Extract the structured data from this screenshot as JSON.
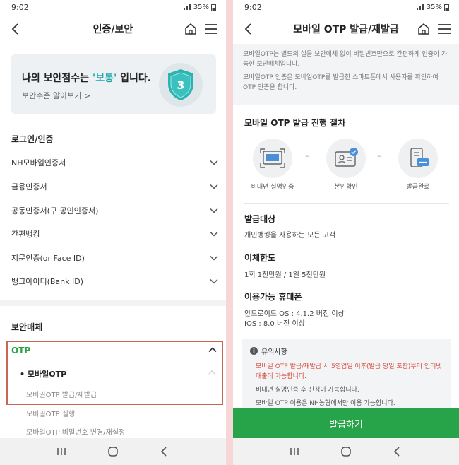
{
  "left": {
    "status": {
      "time": "9:02",
      "battery": "35%"
    },
    "header": {
      "title": "인증/보안"
    },
    "score_card": {
      "title_prefix": "나의 보안점수는 ",
      "title_highlight": "'보통'",
      "title_suffix": " 입니다.",
      "link": "보안수준 알아보기 >",
      "badge_number": "3"
    },
    "login_section": {
      "title": "로그인/인증",
      "items": [
        {
          "label": "NH모바일인증서"
        },
        {
          "label": "금융인증서"
        },
        {
          "label": "공동인증서(구 공인인증서)"
        },
        {
          "label": "간편뱅킹"
        },
        {
          "label": "지문인증(or Face ID)"
        },
        {
          "label": "뱅크아이디(Bank ID)"
        }
      ]
    },
    "security_section": {
      "title": "보안매체",
      "otp_label": "OTP",
      "mobile_otp_label": "• 모바일OTP",
      "sub_items": [
        {
          "label": "모바일OTP 발급/재발급"
        },
        {
          "label": "모바일OTP 실행"
        },
        {
          "label": "모바일OTP 비밀번호 변경/재설정"
        }
      ]
    }
  },
  "right": {
    "status": {
      "time": "9:02",
      "battery": "35%"
    },
    "header": {
      "title": "모바일 OTP 발급/재발급"
    },
    "info": [
      "모바일OTP는 별도의 실물 보안매체 없이 비밀번호만으로 간편하게 인증이 가능한 보안매체입니다.",
      "모바일OTP 인증은 모바일OTP를 발급한 스마트폰에서 사용자를 확인하여 OTP 인증을 합니다."
    ],
    "process": {
      "title": "모바일 OTP 발급 진행 절차",
      "steps": [
        {
          "label": "비대면 실명인증"
        },
        {
          "label": "본인확인"
        },
        {
          "label": "발급완료"
        }
      ]
    },
    "target": {
      "title": "발급대상",
      "text": "개인뱅킹을 사용하는 모든 고객"
    },
    "limit": {
      "title": "이체한도",
      "text": "1회 1천만원 / 1일 5천만원"
    },
    "phones": {
      "title": "이용가능 휴대폰",
      "android": "안드로이드 OS : 4.1.2 버전 이상",
      "ios": "IOS : 8.0 버전 이상"
    },
    "notice": {
      "title": "유의사항",
      "items": [
        {
          "text": "모바일 OTP 발급/재발급 시 5영업일 이후(발급 당일 포함)부터 인터넷 대출이 가능합니다."
        },
        {
          "text": "비대면 실명인증 후 신청이 가능합니다."
        },
        {
          "text": "모바일 OTP 이용은 NH농협에서만 이용 가능합니다."
        }
      ]
    },
    "button": {
      "label": "발급하기"
    }
  },
  "colors": {
    "accent_green": "#27a34a",
    "highlight_teal": "#1fa6a6",
    "warning_red": "#d9493a",
    "focus_border": "#c96755"
  }
}
